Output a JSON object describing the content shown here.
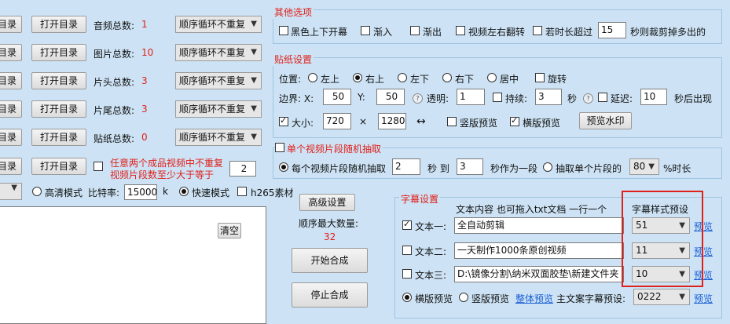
{
  "left_rows": [
    {
      "btn1": "目录",
      "btn2": "打开目录",
      "label": "音频总数:",
      "count": "1",
      "select": "顺序循环不重复"
    },
    {
      "btn1": "目录",
      "btn2": "打开目录",
      "label": "图片总数:",
      "count": "10",
      "select": "顺序循环不重复"
    },
    {
      "btn1": "目录",
      "btn2": "打开目录",
      "label": "片头总数:",
      "count": "3",
      "select": "顺序循环不重复"
    },
    {
      "btn1": "目录",
      "btn2": "打开目录",
      "label": "片尾总数:",
      "count": "3",
      "select": "顺序循环不重复"
    },
    {
      "btn1": "目录",
      "btn2": "打开目录",
      "label": "贴纸总数:",
      "count": "0",
      "select": "顺序循环不重复"
    }
  ],
  "row6": {
    "btn1": "目录",
    "btn2": "打开目录",
    "text_line1": "任意两个成品视频中不重复",
    "text_line2": "视频片段数至少大于等于",
    "value": "2"
  },
  "mode_row": {
    "hd": "高清模式",
    "bitrate_label": "比特率:",
    "bitrate": "15000",
    "unit": "k",
    "fast": "快速模式",
    "h265": "h265素材"
  },
  "clear_label": "清空",
  "advanced_label": "高级设置",
  "max_label": "顺序最大数量:",
  "max_value": "32",
  "start_label": "开始合成",
  "stop_label": "停止合成",
  "other": {
    "title": "其他选项",
    "black": "黑色上下开幕",
    "fadein": "渐入",
    "fadeout": "渐出",
    "flip": "视频左右翻转",
    "overlen": "若时长超过",
    "overlen_value": "15",
    "overlen_tail": "秒则裁剪掉多出的"
  },
  "sticker": {
    "title": "贴纸设置",
    "pos_label": "位置:",
    "pos": [
      "左上",
      "右上",
      "左下",
      "右下",
      "居中"
    ],
    "rotate": "旋转",
    "margin_label": "边界: X:",
    "x": "50",
    "y_label": "Y:",
    "y": "50",
    "alpha_label": "透明:",
    "alpha": "1",
    "dur_label": "持续:",
    "dur": "3",
    "sec": "秒",
    "delay_label": "延迟:",
    "delay": "10",
    "after": "秒后出现",
    "size_label": "大小:",
    "w": "720",
    "times": "×",
    "h": "1280",
    "swap": "↔",
    "vert_preview": "竖版预览",
    "horiz_preview": "横版预览",
    "wm_preview": "预览水印"
  },
  "random": {
    "title": "单个视频片段随机抽取",
    "each": "每个视频片段随机抽取",
    "from": "2",
    "to_label": "秒 到",
    "to": "3",
    "as_seg": "秒作为一段",
    "extract": "抽取单个片段的",
    "pct": "80",
    "pct_label": "%时长"
  },
  "subtitle": {
    "title": "字幕设置",
    "content_header": "文本内容 也可拖入txt文档 一行一个",
    "style_header": "字幕样式预设",
    "rows": [
      {
        "label": "文本一:",
        "text": "全自动剪辑",
        "style": "51",
        "preview": "预览"
      },
      {
        "label": "文本二:",
        "text": "一天制作1000条原创视频",
        "style": "11",
        "preview": "预览"
      },
      {
        "label": "文本三:",
        "text": "D:\\镜像分割\\纳米双面胶垫\\新建文件夹",
        "style": "10",
        "preview": "预览"
      }
    ],
    "horiz": "横版预览",
    "vert": "竖版预览",
    "overall": "整体预览",
    "main_label": "主文案字幕预设:",
    "main_value": "0222",
    "main_preview": "预览"
  },
  "colors": {
    "highlight": "#e0201a",
    "link": "#1a5fd6"
  }
}
